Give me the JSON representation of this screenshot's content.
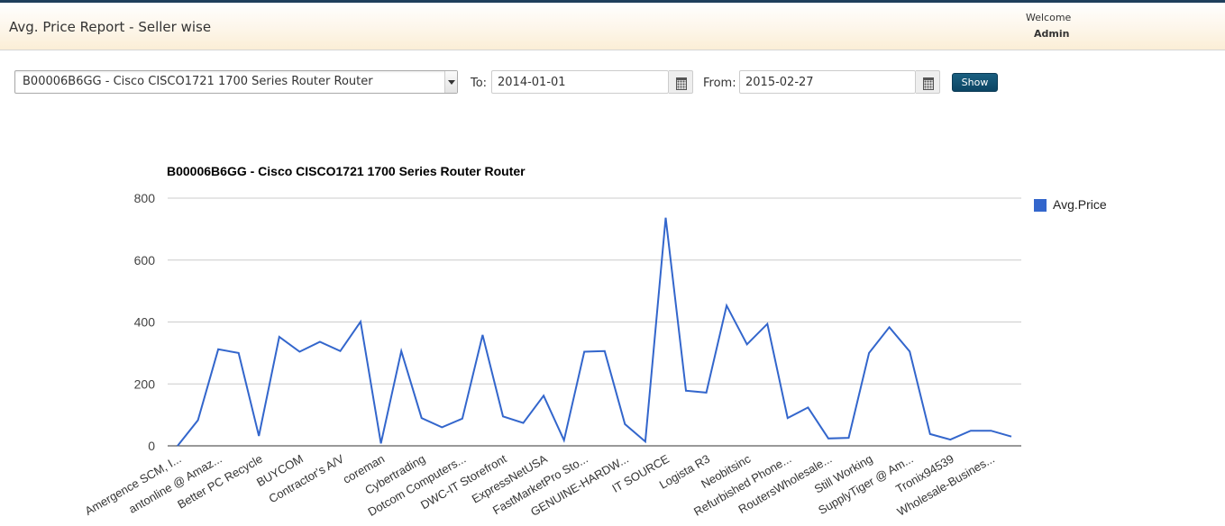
{
  "header": {
    "title": "Avg. Price Report - Seller wise",
    "welcome": "Welcome",
    "user": "Admin"
  },
  "filters": {
    "product": "B00006B6GG - Cisco CISCO1721 1700 Series Router Router",
    "to_label": "To:",
    "to_value": "2014-01-01",
    "from_label": "From:",
    "from_value": "2015-02-27",
    "show_label": "Show"
  },
  "colors": {
    "series": "#3366cc",
    "accent": "#0c4564"
  },
  "chart_data": {
    "type": "line",
    "title": "B00006B6GG - Cisco CISCO1721 1700 Series Router Router",
    "ylim": [
      0,
      800
    ],
    "yticks": [
      0,
      200,
      400,
      600,
      800
    ],
    "grid": true,
    "legend_position": "right",
    "x_labels": [
      "Amergence SCM, I...",
      "antonline @ Amaz...",
      "Better PC Recycle",
      "BUYCOM",
      "Contractor's A/V",
      "coreman",
      "Cybertrading",
      "Dotcom Computers...",
      "DWC-IT Storefront",
      "ExpressNetUSA",
      "FastMarketPro Sto...",
      "GENUINE-HARDW...",
      "IT SOURCE",
      "Logista R3",
      "Neobitsinc",
      "Refurbished Phone...",
      "RoutersWholesale...",
      "Still Working",
      "SupplyTiger @ Am...",
      "Tronix94539",
      "Wholesale-Busines..."
    ],
    "series": [
      {
        "name": "Avg.Price",
        "values": [
          0,
          83,
          312,
          300,
          32,
          352,
          304,
          336,
          306,
          401,
          8,
          306,
          90,
          60,
          88,
          358,
          95,
          74,
          162,
          18,
          304,
          306,
          70,
          14,
          737,
          178,
          172,
          453,
          328,
          394,
          90,
          124,
          24,
          26,
          300,
          383,
          305,
          38,
          20,
          49,
          49,
          30
        ]
      }
    ]
  }
}
